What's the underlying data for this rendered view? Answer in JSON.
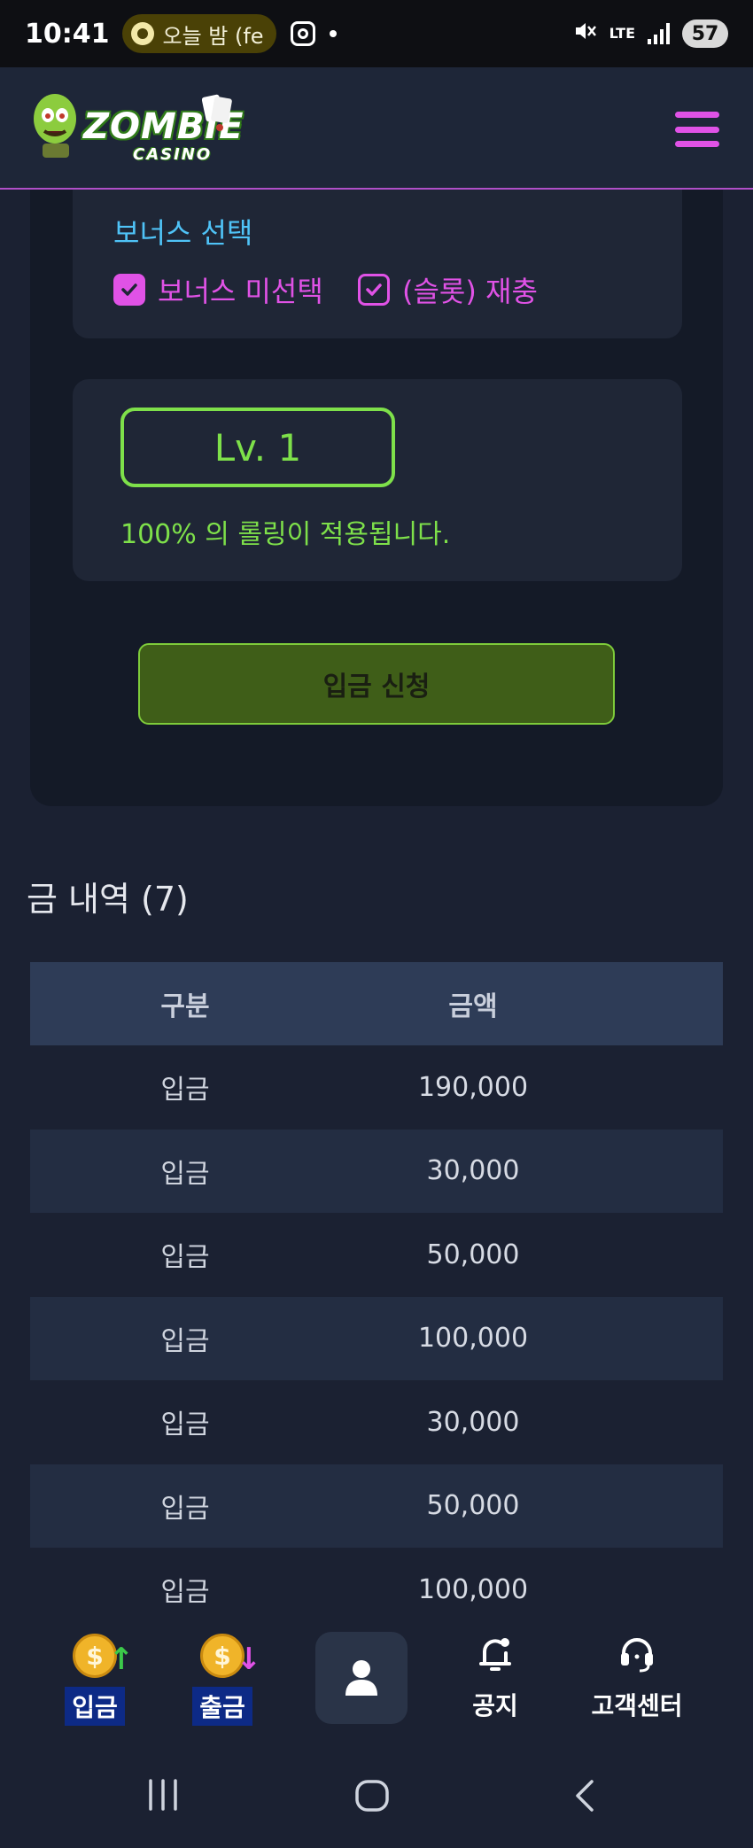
{
  "status_bar": {
    "time": "10:41",
    "media_text": "오늘 밤 (fe",
    "battery": "57",
    "network": "LTE"
  },
  "header": {
    "logo_line1": "ZOMBIE",
    "logo_line2": "CASINO",
    "accent_color": "#e052e6"
  },
  "bonus": {
    "title": "보너스 선택",
    "options": [
      {
        "label": "보너스 미선택",
        "checked": true,
        "style": "filled"
      },
      {
        "label": "(슬롯) 재충",
        "checked": true,
        "style": "outline"
      }
    ]
  },
  "level": {
    "badge": "Lv. 1",
    "note": "100% 의 롤링이 적용됩니다.",
    "color": "#7ee04a"
  },
  "apply_button": "입금 신청",
  "history": {
    "title": "금 내역 (7)",
    "columns": [
      "구분",
      "금액"
    ],
    "rows": [
      [
        "입금",
        "190,000"
      ],
      [
        "입금",
        "30,000"
      ],
      [
        "입금",
        "50,000"
      ],
      [
        "입금",
        "100,000"
      ],
      [
        "입금",
        "30,000"
      ],
      [
        "입금",
        "50,000"
      ],
      [
        "입금",
        "100,000"
      ]
    ]
  },
  "bottom_nav": {
    "deposit": "입금",
    "withdraw": "출금",
    "notice": "공지",
    "support": "고객센터",
    "center_icon": "user-icon"
  }
}
